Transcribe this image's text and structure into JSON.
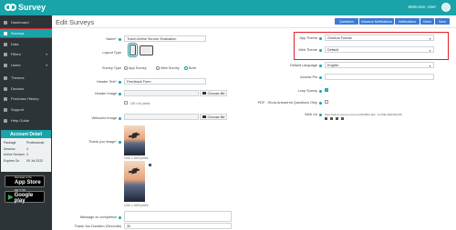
{
  "header": {
    "app_name": "Survey",
    "welcome": "Welcome, User"
  },
  "sidebar": {
    "items": [
      {
        "label": "Dashboard",
        "icon": "dashboard-icon"
      },
      {
        "label": "Surveys",
        "icon": "surveys-icon"
      },
      {
        "label": "Data",
        "icon": "data-icon"
      },
      {
        "label": "Filters",
        "icon": "filter-icon"
      },
      {
        "label": "Users",
        "icon": "users-icon"
      },
      {
        "label": "Themes",
        "icon": "themes-icon"
      },
      {
        "label": "Devices",
        "icon": "devices-icon"
      },
      {
        "label": "Purchase History",
        "icon": "cart-icon"
      },
      {
        "label": "Support",
        "icon": "support-icon"
      },
      {
        "label": "Help Guide",
        "icon": "help-icon"
      }
    ],
    "account": {
      "title": "Account Detail",
      "rows": [
        {
          "k": "Package",
          "v": "Professional"
        },
        {
          "k": "Devices",
          "v": "4"
        },
        {
          "k": "Active Devices",
          "v": "3"
        },
        {
          "k": "Expires On",
          "v": "09 Jul 2022"
        }
      ]
    },
    "stores": [
      {
        "small": "Download on the",
        "big": "App Store"
      },
      {
        "small": "GET IT ON",
        "big": "Google play"
      }
    ]
  },
  "main": {
    "title": "Edit Surveys",
    "buttons": [
      "Questions",
      "Advance Notifications",
      "Notifications",
      "Users",
      "Save"
    ],
    "fields": {
      "name_label": "Name",
      "name_value": "Travel Airline Service Evaluation",
      "layout_label": "Layout Type",
      "survey_type_label": "Survey Type",
      "survey_type_options": [
        "App Survey",
        "Web Survey",
        "Both"
      ],
      "header_text_label": "Header Text",
      "header_text_value": "Feedback Form",
      "header_image_label": "Header Image",
      "choose_file": "Choose file",
      "header_size": "100 x 40 pixels",
      "welcome_image_label": "Welcome Image",
      "welcome_size": "1240 x 1600 pixels",
      "thank_image_label": "Thank you Image",
      "thank_size": "1240 x 1600 pixels",
      "message_label": "Message on completion",
      "duration_label": "Thank You Duration (Seconds)",
      "duration_value": "30"
    },
    "right": {
      "app_theme_label": "App Theme",
      "app_theme_value": "General Format",
      "web_theme_label": "Web Theme",
      "web_theme_value": "Default",
      "default_lang_label": "Default Language",
      "default_lang_value": "English",
      "access_pin_label": "Access Pin",
      "loop_label": "Loop Survey",
      "pdf_label": "PDF - Show Answered Questions Only",
      "web_url_label": "Web Url",
      "web_url_value": "https://admin.qsurvey.in/survey/6/E3862-3E4...A1-B3E-0B4F5E2338"
    }
  },
  "colors": {
    "teal": "#1aa3a8",
    "sidebar": "#2d3438",
    "highlight": "#e0202a",
    "button": "#3a7bd5"
  }
}
